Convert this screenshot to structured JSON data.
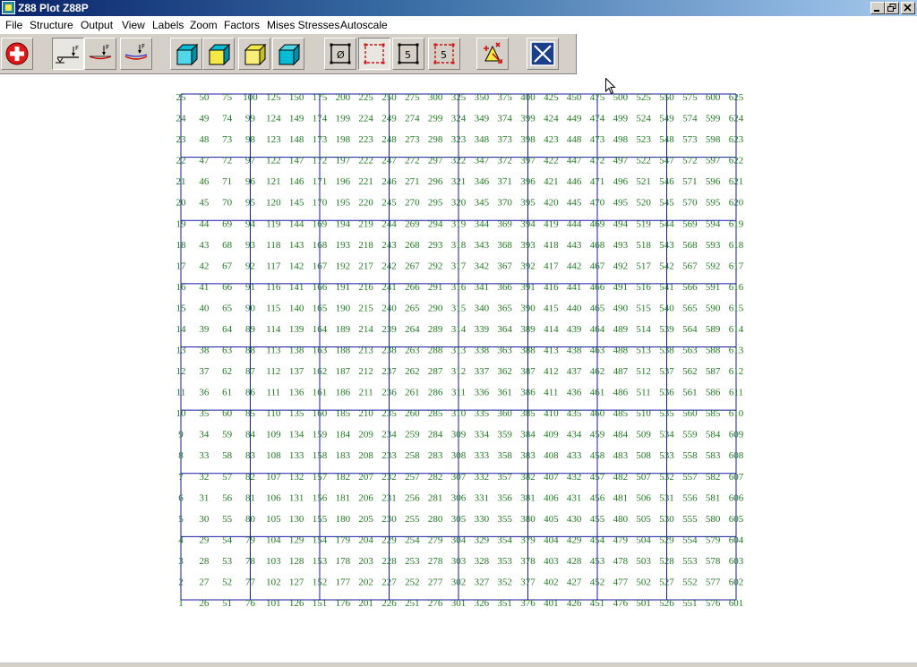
{
  "window": {
    "title": "Z88 Plot Z88P"
  },
  "menu": [
    "File",
    "Structure",
    "Output",
    "View",
    "Labels",
    "Zoom",
    "Factors",
    "Mises Stresses",
    "Autoscale"
  ],
  "toolbar_buttons": [
    {
      "name": "exit-red-cross-icon",
      "pressed": false
    },
    {
      "name": "structure-undeformed-icon",
      "pressed": true
    },
    {
      "name": "structure-deformed-icon",
      "pressed": false
    },
    {
      "name": "structure-both-icon",
      "pressed": false
    },
    {
      "name": "view-cube-cyan-icon",
      "pressed": false
    },
    {
      "name": "view-cube-yellow-cyan-icon",
      "pressed": false
    },
    {
      "name": "view-cube-yellow-icon",
      "pressed": false
    },
    {
      "name": "view-cube-cyan-alt-icon",
      "pressed": false
    },
    {
      "name": "labels-none-icon",
      "label": "Ø",
      "pressed": false
    },
    {
      "name": "labels-elements-icon",
      "label": "",
      "pressed": true
    },
    {
      "name": "labels-nodes-icon",
      "label": "5",
      "pressed": false
    },
    {
      "name": "labels-both-icon",
      "label": "5",
      "pressed": false
    },
    {
      "name": "zoom-pan-icon",
      "pressed": false
    },
    {
      "name": "close-plot-icon",
      "pressed": false
    }
  ],
  "mesh": {
    "node_columns": 25,
    "node_rows": 25,
    "element_columns": 8,
    "element_rows": 8,
    "line_color": "#1a1aaa",
    "label_color": "#1e7a1e"
  }
}
